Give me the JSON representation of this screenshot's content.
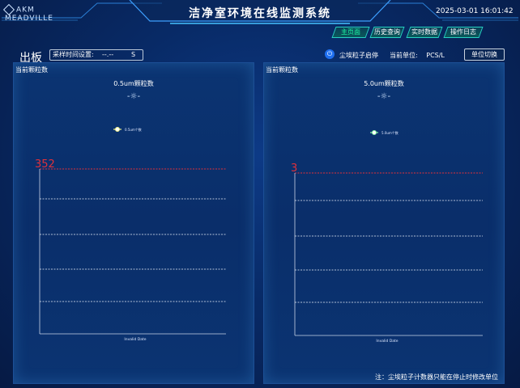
{
  "header": {
    "logo_text": "AKM MEADVILLE",
    "title": "洁净室环境在线监测系统",
    "datetime": "2025-03-01 16:01:42",
    "nav": [
      {
        "label": "主页面",
        "active": true
      },
      {
        "label": "历史查询",
        "active": false
      },
      {
        "label": "实时数据",
        "active": false
      },
      {
        "label": "操作日志",
        "active": false
      }
    ]
  },
  "toolbar": {
    "board_title": "出板",
    "sample_time_label": "采样时间设置:",
    "sample_time_value": "--.--",
    "sample_time_unit": "S",
    "dust_toggle_label": "尘埃粒子启停",
    "unit_label": "当前单位:",
    "unit_value": "PCS/L",
    "unit_switch_button": "单位切换"
  },
  "panels": [
    {
      "header": "当前颗粒数",
      "chart_title": "0.5um颗粒数",
      "legend_toggle": "-☼-",
      "chart_data": {
        "type": "line",
        "title": "0.5um颗粒数",
        "series": [
          {
            "name": "0.5um个数",
            "color": "#f5f58a",
            "values": []
          }
        ],
        "limit_value": "352",
        "limit_color": "#e0303a",
        "xlabel": "Invalid Date",
        "grid": true
      }
    },
    {
      "header": "当前颗粒数",
      "chart_title": "5.0um颗粒数",
      "legend_toggle": "-☼-",
      "chart_data": {
        "type": "line",
        "title": "5.0um颗粒数",
        "series": [
          {
            "name": "5.0um个数",
            "color": "#8af5a6",
            "values": []
          }
        ],
        "limit_value": "3",
        "limit_color": "#e0303a",
        "xlabel": "Invalid Date",
        "grid": true
      }
    }
  ],
  "footer": {
    "note": "注：尘埃粒子计数器只能在停止时修改单位"
  }
}
